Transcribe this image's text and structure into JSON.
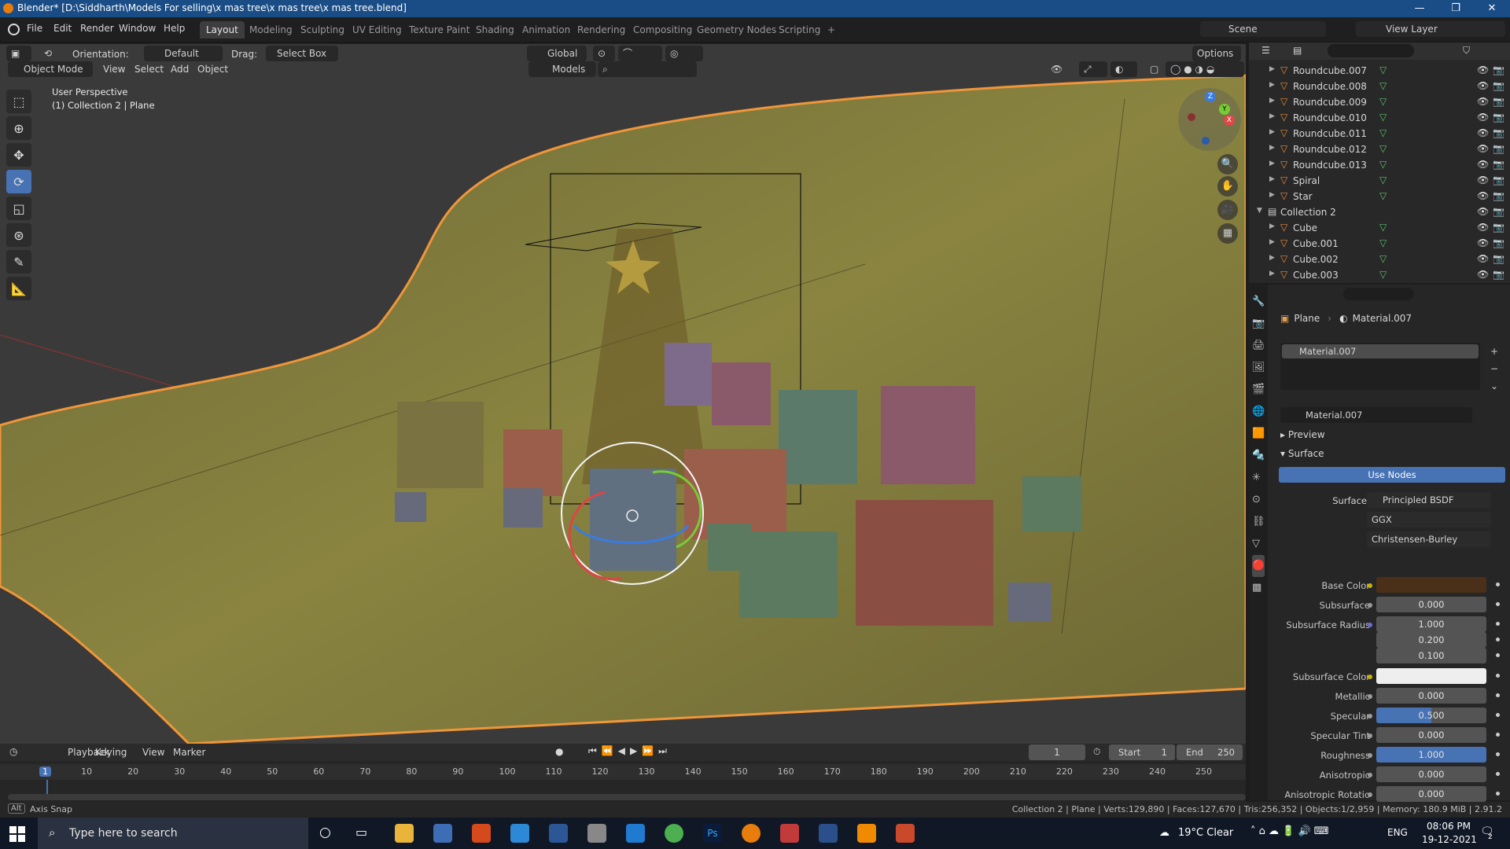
{
  "titlebar": {
    "title": "Blender* [D:\\Siddharth\\Models For selling\\x mas tree\\x mas tree\\x mas tree.blend]",
    "minimize": "—",
    "maximize": "❐",
    "close": "✕"
  },
  "menu": {
    "items": [
      "File",
      "Edit",
      "Render",
      "Window",
      "Help"
    ]
  },
  "workspaces": [
    "Layout",
    "Modeling",
    "Sculpting",
    "UV Editing",
    "Texture Paint",
    "Shading",
    "Animation",
    "Rendering",
    "Compositing",
    "Geometry Nodes",
    "Scripting",
    "+"
  ],
  "workspace_active": "Layout",
  "scene": {
    "scene_name": "Scene",
    "view_layer": "View Layer"
  },
  "header": {
    "orientation_label": "Orientation:",
    "orientation_value": "Default",
    "drag_label": "Drag:",
    "drag_value": "Select Box",
    "transform": "Global",
    "options": "Options",
    "mode": "Object Mode",
    "view": "View",
    "select": "Select",
    "add": "Add",
    "object": "Object",
    "collection_filter": "Models"
  },
  "viewport": {
    "overlay_title": "User Perspective",
    "overlay_sub": "(1) Collection 2 | Plane",
    "gizmo_axes": [
      "X",
      "Y",
      "Z"
    ]
  },
  "outliner": {
    "rows": [
      {
        "name": "Roundcube.007",
        "level": 1
      },
      {
        "name": "Roundcube.008",
        "level": 1
      },
      {
        "name": "Roundcube.009",
        "level": 1
      },
      {
        "name": "Roundcube.010",
        "level": 1
      },
      {
        "name": "Roundcube.011",
        "level": 1
      },
      {
        "name": "Roundcube.012",
        "level": 1
      },
      {
        "name": "Roundcube.013",
        "level": 1
      },
      {
        "name": "Spiral",
        "level": 1
      },
      {
        "name": "Star",
        "level": 1
      },
      {
        "name": "Collection 2",
        "level": 0
      },
      {
        "name": "Cube",
        "level": 1
      },
      {
        "name": "Cube.001",
        "level": 1
      },
      {
        "name": "Cube.002",
        "level": 1
      },
      {
        "name": "Cube.003",
        "level": 1
      }
    ]
  },
  "properties": {
    "breadcrumb_object": "Plane",
    "breadcrumb_material": "Material.007",
    "slot_name": "Material.007",
    "material_name": "Material.007",
    "preview_label": "Preview",
    "surface_label": "Surface",
    "use_nodes": "Use Nodes",
    "surface_field_label": "Surface",
    "surface_shader": "Principled BSDF",
    "distribution": "GGX",
    "subsurface_method": "Christensen-Burley",
    "fields": [
      {
        "label": "Base Color",
        "type": "color",
        "color": "#4a3018",
        "dot": "#c9b000"
      },
      {
        "label": "Subsurface",
        "value": "0.000",
        "dot": "#9a9a9a"
      },
      {
        "label": "Subsurface Radius",
        "value": "1.000",
        "dot": "#6b6bd0"
      },
      {
        "label": "",
        "value": "0.200"
      },
      {
        "label": "",
        "value": "0.100"
      },
      {
        "label": "Subsurface Color",
        "type": "color",
        "color": "#eeeeee",
        "dot": "#c9b000"
      },
      {
        "label": "Metallic",
        "value": "0.000",
        "dot": "#9a9a9a"
      },
      {
        "label": "Specular",
        "value": "0.500",
        "fill": 0.5,
        "dot": "#9a9a9a"
      },
      {
        "label": "Specular Tint",
        "value": "0.000",
        "dot": "#9a9a9a"
      },
      {
        "label": "Roughness",
        "value": "1.000",
        "fill": 1.0,
        "dot": "#9a9a9a"
      },
      {
        "label": "Anisotropic",
        "value": "0.000",
        "dot": "#9a9a9a"
      },
      {
        "label": "Anisotropic Rotatio",
        "value": "0.000",
        "dot": "#9a9a9a"
      }
    ]
  },
  "timeline": {
    "menus": [
      "Playback",
      "Keying",
      "View",
      "Marker"
    ],
    "current_frame": "1",
    "start_label": "Start",
    "start": "1",
    "end_label": "End",
    "end": "250",
    "ruler": [
      "1",
      "10",
      "20",
      "30",
      "40",
      "50",
      "60",
      "70",
      "80",
      "90",
      "100",
      "110",
      "120",
      "130",
      "140",
      "150",
      "160",
      "170",
      "180",
      "190",
      "200",
      "210",
      "220",
      "230",
      "240",
      "250"
    ]
  },
  "statusbar": {
    "key": "Alt",
    "hint": "Axis Snap",
    "stats": "Collection 2 | Plane | Verts:129,890 | Faces:127,670 | Tris:256,352 | Objects:1/2,959 | Memory: 180.9 MiB | 2.91.2"
  },
  "taskbar": {
    "search_placeholder": "Type here to search",
    "weather": "19°C  Clear",
    "lang": "ENG",
    "time": "08:06 PM",
    "date": "19-12-2021",
    "notif": "2"
  },
  "colors": {
    "accent": "#4772b3",
    "selection": "#f0963a",
    "plane": "#807a3e",
    "titlebar": "#1a4d86"
  }
}
